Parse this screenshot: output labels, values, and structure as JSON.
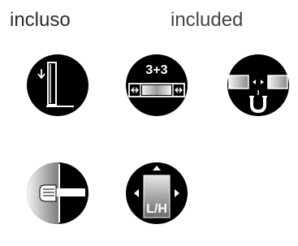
{
  "header": {
    "label_it": "incluso",
    "label_en": "included"
  },
  "icons": [
    {
      "name": "vertical-profile-icon"
    },
    {
      "name": "three-plus-three-panel-icon",
      "text": "3+3"
    },
    {
      "name": "magnetic-closure-icon"
    },
    {
      "name": "handle-door-icon"
    },
    {
      "name": "left-right-hinge-icon",
      "text": "L/H"
    }
  ],
  "colors": {
    "icon_fill": "#000000",
    "icon_line": "#ffffff",
    "gradient_light": "#f2f2f2",
    "gradient_dark": "#7a7a7a"
  }
}
